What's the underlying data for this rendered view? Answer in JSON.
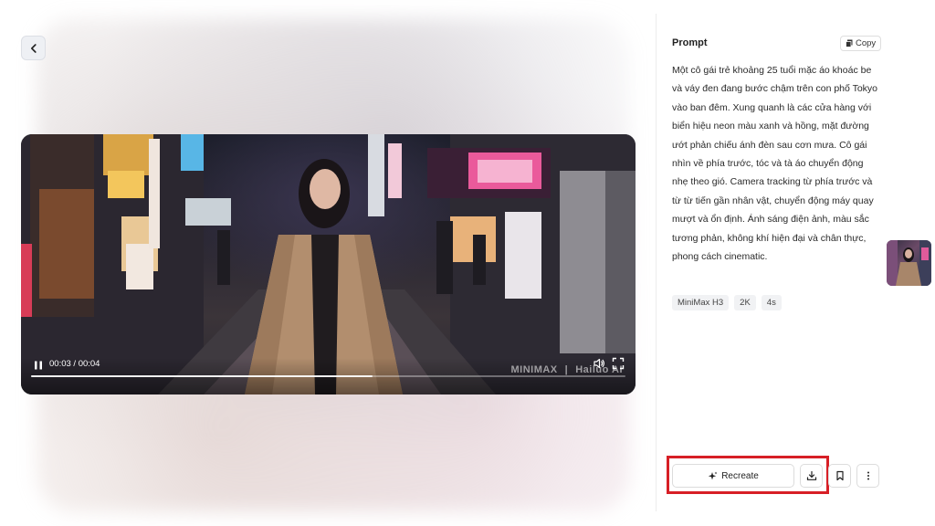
{
  "prompt": {
    "title": "Prompt",
    "copy_label": "Copy",
    "text": "Một cô gái trẻ khoảng 25 tuổi mặc áo khoác be và váy đen đang bước chậm trên con phố Tokyo vào ban đêm. Xung quanh là các cửa hàng với biển hiệu neon màu xanh và hồng, mặt đường ướt phản chiếu ánh đèn sau cơn mưa. Cô gái nhìn về phía trước, tóc và tà áo chuyển động nhẹ theo gió. Camera tracking từ phía trước và từ từ tiến gần nhân vật, chuyển động máy quay mượt và ổn định. Ánh sáng điện ảnh, màu sắc tương phản, không khí hiện đại và chân thực, phong cách cinematic.",
    "tags": [
      "MiniMax H3",
      "2K",
      "4s"
    ]
  },
  "player": {
    "time": "00:03 / 00:04",
    "progress": 0.575,
    "watermark_left": "MINIMAX",
    "watermark_right": "Hailuo AI"
  },
  "actions": {
    "recreate_label": "Recreate"
  },
  "icons": {
    "back": "chevron-left-icon",
    "copy": "copy-icon",
    "pause": "pause-icon",
    "volume": "volume-icon",
    "fullscreen": "fullscreen-icon",
    "sparkle": "sparkle-icon",
    "download": "download-icon",
    "bookmark": "bookmark-icon",
    "more": "more-vertical-icon"
  },
  "colors": {
    "highlight": "#d71f26"
  }
}
